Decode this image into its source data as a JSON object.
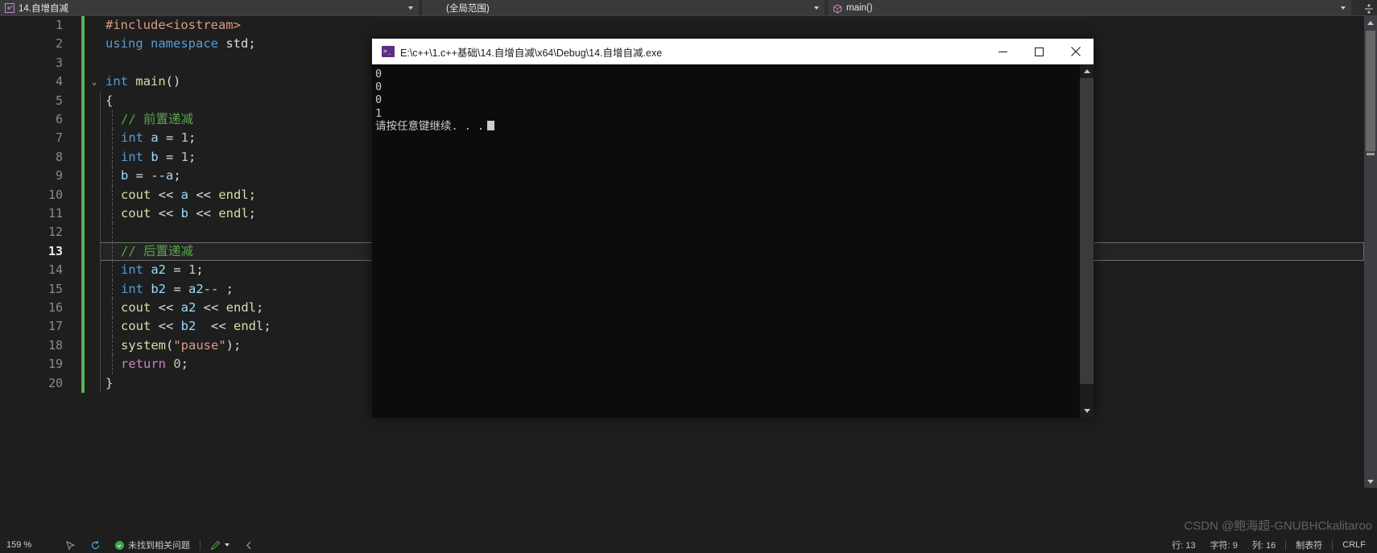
{
  "navbar": {
    "file_name": "14.自增自减",
    "scope": "(全局范围)",
    "function": "main()",
    "icons": {
      "file": "cpp-file-icon",
      "function": "cube-icon",
      "split": "split-view-icon"
    }
  },
  "editor": {
    "current_line": 13,
    "lines": [
      {
        "n": 1,
        "tokens": [
          {
            "t": "#include",
            "c": "t-pre"
          },
          {
            "t": "<iostream>",
            "c": "t-pre"
          }
        ],
        "indent": 0
      },
      {
        "n": 2,
        "tokens": [
          {
            "t": "using ",
            "c": "t-kw"
          },
          {
            "t": "namespace ",
            "c": "t-kw"
          },
          {
            "t": "std",
            "c": "t-plain"
          },
          {
            "t": ";",
            "c": "t-plain"
          }
        ],
        "indent": 0
      },
      {
        "n": 3,
        "tokens": [],
        "indent": 0
      },
      {
        "n": 4,
        "tokens": [
          {
            "t": "int ",
            "c": "t-kw"
          },
          {
            "t": "main",
            "c": "t-fn"
          },
          {
            "t": "()",
            "c": "t-plain"
          }
        ],
        "indent": 0
      },
      {
        "n": 5,
        "tokens": [
          {
            "t": "{",
            "c": "t-plain"
          }
        ],
        "indent": 0
      },
      {
        "n": 6,
        "tokens": [
          {
            "t": "// 前置递减",
            "c": "t-com"
          }
        ],
        "indent": 1
      },
      {
        "n": 7,
        "tokens": [
          {
            "t": "int ",
            "c": "t-kw"
          },
          {
            "t": "a",
            "c": "t-var"
          },
          {
            "t": " = ",
            "c": "t-plain"
          },
          {
            "t": "1",
            "c": "t-num"
          },
          {
            "t": ";",
            "c": "t-plain"
          }
        ],
        "indent": 1
      },
      {
        "n": 8,
        "tokens": [
          {
            "t": "int ",
            "c": "t-kw"
          },
          {
            "t": "b",
            "c": "t-var"
          },
          {
            "t": " = ",
            "c": "t-plain"
          },
          {
            "t": "1",
            "c": "t-num"
          },
          {
            "t": ";",
            "c": "t-plain"
          }
        ],
        "indent": 1
      },
      {
        "n": 9,
        "tokens": [
          {
            "t": "b",
            "c": "t-var"
          },
          {
            "t": " = ",
            "c": "t-plain"
          },
          {
            "t": "--",
            "c": "t-plain"
          },
          {
            "t": "a",
            "c": "t-var"
          },
          {
            "t": ";",
            "c": "t-plain"
          }
        ],
        "indent": 1
      },
      {
        "n": 10,
        "tokens": [
          {
            "t": "cout",
            "c": "t-fn"
          },
          {
            "t": " << ",
            "c": "t-plain"
          },
          {
            "t": "a",
            "c": "t-var"
          },
          {
            "t": " << ",
            "c": "t-plain"
          },
          {
            "t": "endl",
            "c": "t-fn"
          },
          {
            "t": ";",
            "c": "t-plain"
          }
        ],
        "indent": 1
      },
      {
        "n": 11,
        "tokens": [
          {
            "t": "cout",
            "c": "t-fn"
          },
          {
            "t": " << ",
            "c": "t-plain"
          },
          {
            "t": "b",
            "c": "t-var"
          },
          {
            "t": " << ",
            "c": "t-plain"
          },
          {
            "t": "endl",
            "c": "t-fn"
          },
          {
            "t": ";",
            "c": "t-plain"
          }
        ],
        "indent": 1
      },
      {
        "n": 12,
        "tokens": [],
        "indent": 1
      },
      {
        "n": 13,
        "tokens": [
          {
            "t": "// 后置递减",
            "c": "t-com"
          }
        ],
        "indent": 1
      },
      {
        "n": 14,
        "tokens": [
          {
            "t": "int ",
            "c": "t-kw"
          },
          {
            "t": "a2",
            "c": "t-var"
          },
          {
            "t": " = ",
            "c": "t-plain"
          },
          {
            "t": "1",
            "c": "t-num"
          },
          {
            "t": ";",
            "c": "t-plain"
          }
        ],
        "indent": 1
      },
      {
        "n": 15,
        "tokens": [
          {
            "t": "int ",
            "c": "t-kw"
          },
          {
            "t": "b2",
            "c": "t-var"
          },
          {
            "t": " = ",
            "c": "t-plain"
          },
          {
            "t": "a2",
            "c": "t-var"
          },
          {
            "t": "-- ;",
            "c": "t-plain"
          }
        ],
        "indent": 1
      },
      {
        "n": 16,
        "tokens": [
          {
            "t": "cout",
            "c": "t-fn"
          },
          {
            "t": " << ",
            "c": "t-plain"
          },
          {
            "t": "a2",
            "c": "t-var"
          },
          {
            "t": " << ",
            "c": "t-plain"
          },
          {
            "t": "endl",
            "c": "t-fn"
          },
          {
            "t": ";",
            "c": "t-plain"
          }
        ],
        "indent": 1
      },
      {
        "n": 17,
        "tokens": [
          {
            "t": "cout",
            "c": "t-fn"
          },
          {
            "t": " << ",
            "c": "t-plain"
          },
          {
            "t": "b2",
            "c": "t-var"
          },
          {
            "t": "  << ",
            "c": "t-plain"
          },
          {
            "t": "endl",
            "c": "t-fn"
          },
          {
            "t": ";",
            "c": "t-plain"
          }
        ],
        "indent": 1
      },
      {
        "n": 18,
        "tokens": [
          {
            "t": "system",
            "c": "t-fn"
          },
          {
            "t": "(",
            "c": "t-plain"
          },
          {
            "t": "\"pause\"",
            "c": "t-str"
          },
          {
            "t": ");",
            "c": "t-plain"
          }
        ],
        "indent": 1
      },
      {
        "n": 19,
        "tokens": [
          {
            "t": "return ",
            "c": "t-ctl"
          },
          {
            "t": "0",
            "c": "t-num"
          },
          {
            "t": ";",
            "c": "t-plain"
          }
        ],
        "indent": 1
      },
      {
        "n": 20,
        "tokens": [
          {
            "t": "}",
            "c": "t-plain"
          }
        ],
        "indent": 0
      }
    ]
  },
  "console": {
    "title": "E:\\c++\\1.c++基础\\14.自增自减\\x64\\Debug\\14.自增自减.exe",
    "output_lines": [
      "0",
      "0",
      "0",
      "1"
    ],
    "prompt": "请按任意键继续. . .",
    "buttons": {
      "minimize": "minimize-button",
      "maximize": "maximize-button",
      "close": "close-button"
    }
  },
  "statusbar": {
    "zoom": "159 %",
    "issues": "未找到相关问题",
    "line": "行: 13",
    "char": "字符: 9",
    "col": "列: 16",
    "tabs": "制表符",
    "eol": "CRLF"
  },
  "watermark": "CSDN @鲍海超-GNUBHCkalitaroo"
}
